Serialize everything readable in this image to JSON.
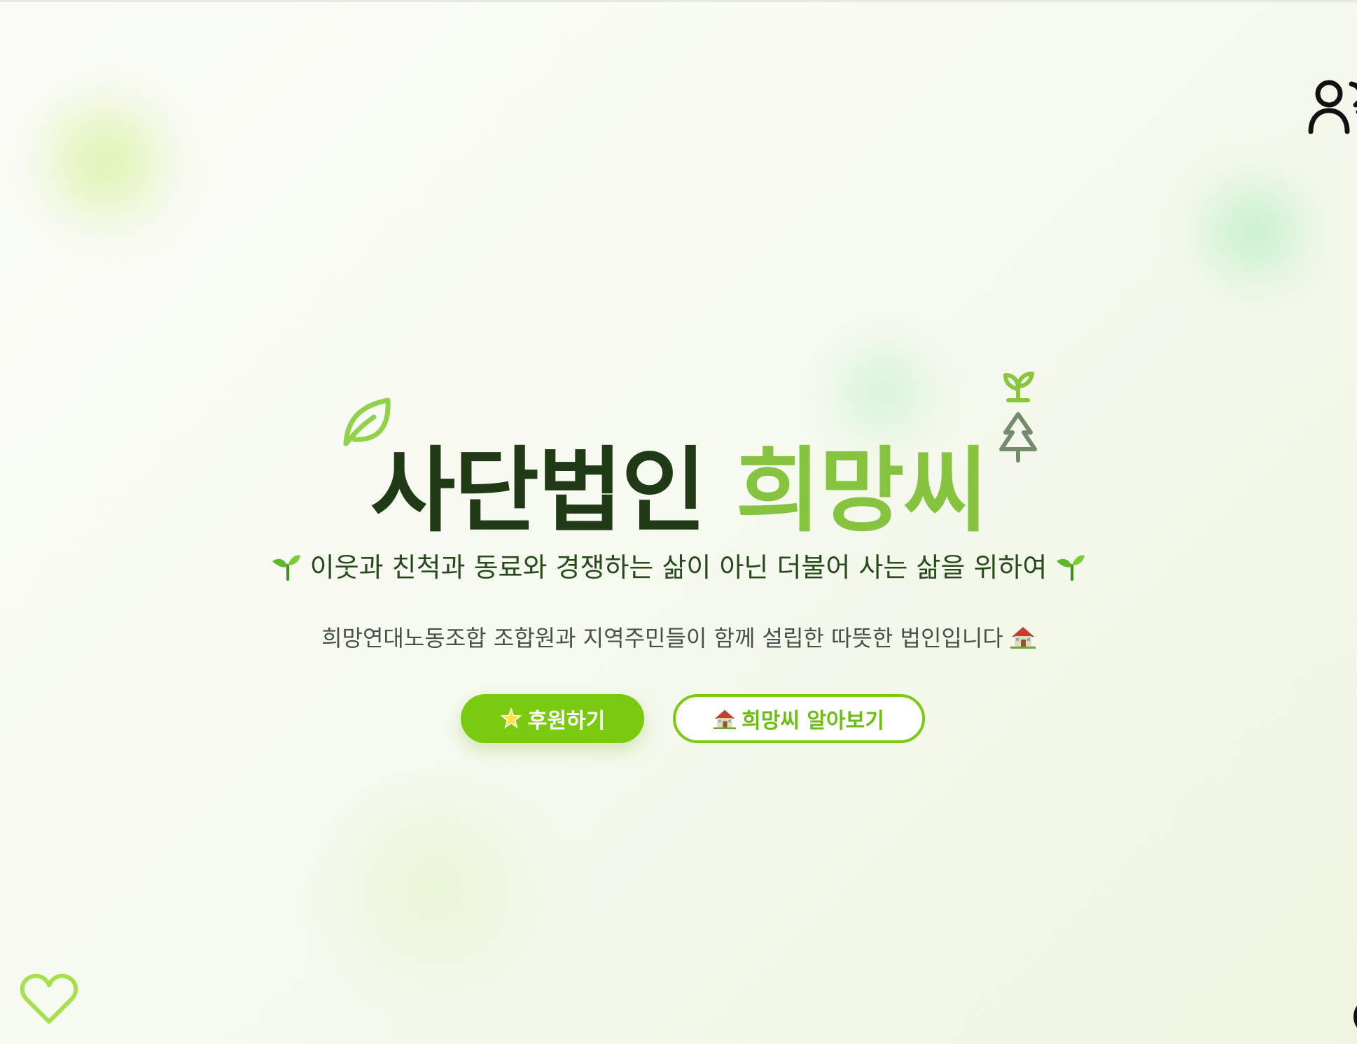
{
  "hero": {
    "title_main": "사단법인",
    "title_accent": "희망씨",
    "tagline": "이웃과 친척과 동료와 경쟁하는 삶이 아닌 더불어 사는 삶을 위하여",
    "subtitle": "희망연대노동조합 조합원과 지역주민들이 함께 설립한 따뜻한 법인입니다"
  },
  "actions": {
    "donate_label": "후원하기",
    "about_label": "희망씨 알아보기"
  },
  "icons": {
    "leaf": "leaf-icon",
    "sprout": "sprout-icon",
    "tree": "tree-icon",
    "house": "house-icon",
    "star": "star-icon",
    "users": "users-icon",
    "heart": "heart-icon"
  },
  "colors": {
    "accent": "#7acb10",
    "title_dark": "#1f3a14",
    "title_green": "#86c440",
    "tagline": "#274a1a",
    "subtitle": "#45504a"
  }
}
